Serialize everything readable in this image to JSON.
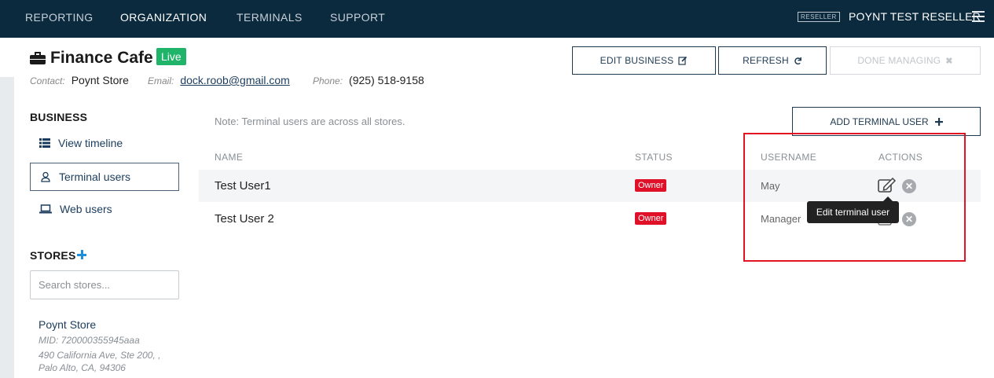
{
  "nav": {
    "items": [
      "REPORTING",
      "ORGANIZATION",
      "TERMINALS",
      "SUPPORT"
    ],
    "active_index": 1,
    "reseller_badge": "RESELLER",
    "reseller_name": "POYNT TEST RESELLER"
  },
  "business": {
    "name": "Finance Cafe",
    "status": "Live",
    "contact_label": "Contact:",
    "contact": "Poynt Store",
    "email_label": "Email:",
    "email": "dock.roob@gmail.com",
    "phone_label": "Phone:",
    "phone": "(925) 518-9158"
  },
  "header_buttons": {
    "edit": "EDIT BUSINESS",
    "refresh": "REFRESH",
    "done": "DONE MANAGING"
  },
  "sidebar": {
    "business_heading": "BUSINESS",
    "items": [
      "View timeline",
      "Terminal users",
      "Web users"
    ],
    "active_index": 1,
    "stores_heading": "STORES",
    "search_placeholder": "Search stores..."
  },
  "store": {
    "name": "Poynt Store",
    "mid": "MID: 720000355945aaa",
    "address_line1": "490 California Ave, Ste 200, ,",
    "address_line2": "Palo Alto, CA, 94306"
  },
  "main": {
    "note": "Note: Terminal users are across all stores.",
    "add_button": "ADD TERMINAL USER",
    "columns": [
      "NAME",
      "STATUS",
      "USERNAME",
      "ACTIONS"
    ],
    "rows": [
      {
        "name": "Test User1",
        "status": "Owner",
        "username": "May"
      },
      {
        "name": "Test User 2",
        "status": "Owner",
        "username": "Manager"
      }
    ],
    "tooltip": "Edit terminal user"
  },
  "colors": {
    "nav_bg": "#0c2a3e",
    "live_green": "#1fb46a",
    "owner_red": "#e01029",
    "highlight_red": "#e01422",
    "link_blue": "#1b3c5c",
    "plus_blue": "#1e90d8"
  },
  "icons": {
    "briefcase": "briefcase-icon",
    "edit": "pencil-square-icon",
    "refresh": "refresh-icon",
    "done": "x-icon",
    "timeline": "list-icon",
    "terminal_users": "user-icon",
    "web_users": "laptop-icon",
    "add": "plus-icon",
    "remove": "remove-circle-icon"
  }
}
